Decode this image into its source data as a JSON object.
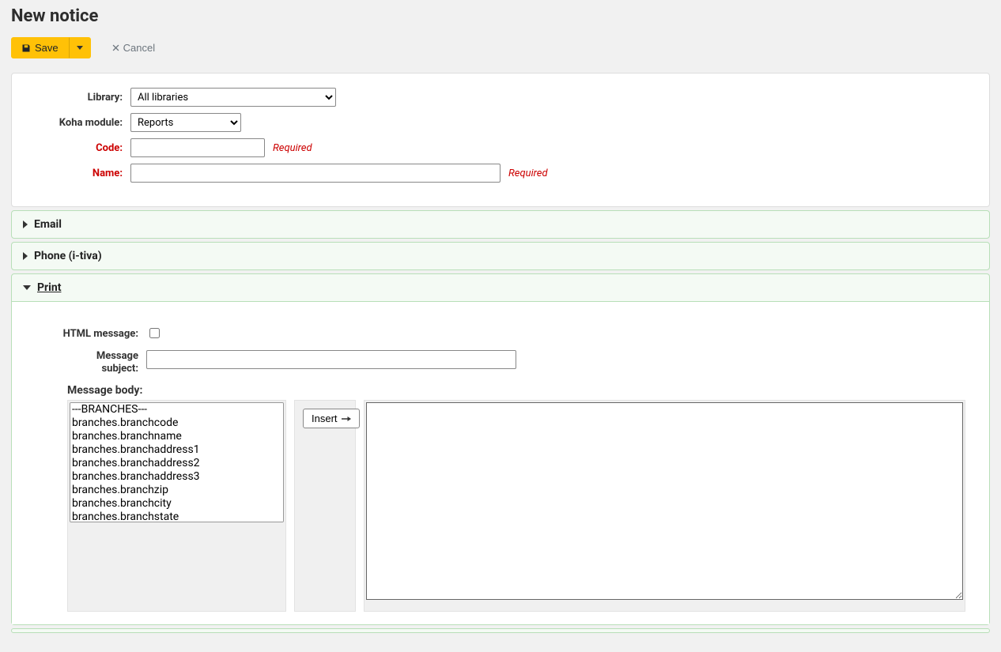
{
  "page_title": "New notice",
  "toolbar": {
    "save_label": "Save",
    "cancel_label": "Cancel"
  },
  "form": {
    "library_label": "Library:",
    "library_selected": "All libraries",
    "module_label": "Koha module:",
    "module_selected": "Reports",
    "code_label": "Code:",
    "code_value": "",
    "name_label": "Name:",
    "name_value": "",
    "required_hint": "Required"
  },
  "accordion": {
    "email": {
      "title": "Email",
      "open": false
    },
    "phone": {
      "title": "Phone (i-tiva)",
      "open": false
    },
    "print": {
      "title": "Print",
      "open": true
    }
  },
  "print_panel": {
    "html_message_label": "HTML message:",
    "html_message_checked": false,
    "subject_label_line1": "Message",
    "subject_label_line2": "subject:",
    "subject_value": "",
    "body_label": "Message body:",
    "insert_label": "Insert",
    "field_options": [
      "---BRANCHES---",
      "branches.branchcode",
      "branches.branchname",
      "branches.branchaddress1",
      "branches.branchaddress2",
      "branches.branchaddress3",
      "branches.branchzip",
      "branches.branchcity",
      "branches.branchstate"
    ],
    "body_value": ""
  }
}
